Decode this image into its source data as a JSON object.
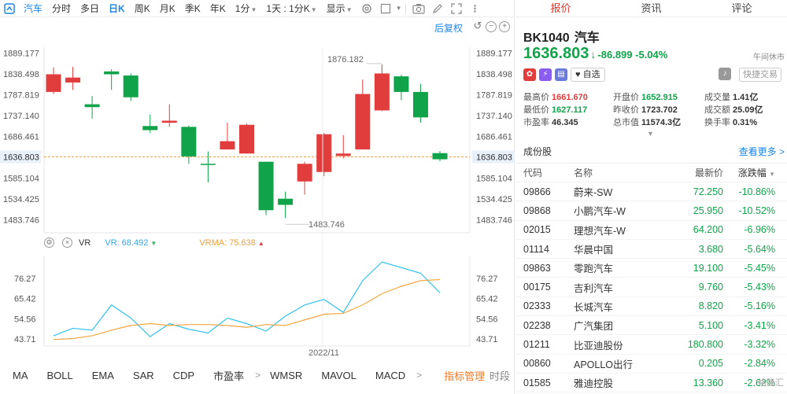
{
  "toolbar": {
    "items": [
      "汽车",
      "分时",
      "多日",
      "日K",
      "周K",
      "月K",
      "季K",
      "年K",
      "1分",
      "1天 : 1分K",
      "显示"
    ],
    "active_index": 3
  },
  "chart": {
    "fuquan_label": "后复权",
    "y_ticks": [
      "1889.177",
      "1838.498",
      "1787.819",
      "1737.140",
      "1686.461",
      "1636.803",
      "1585.104",
      "1534.425",
      "1483.746"
    ],
    "current_price_label": "1636.803",
    "high_label": "1876.182",
    "low_label": "1483.746",
    "x_label": "2022/11",
    "indicator": {
      "name": "VR",
      "vr_label": "VR: 68.492",
      "vrma_label": "VRMA: 75.638",
      "y_ticks": [
        "76.27",
        "65.42",
        "54.56",
        "43.71"
      ]
    }
  },
  "chart_data": [
    {
      "type": "candlestick",
      "ylim": [
        1452,
        1904
      ],
      "candles": [
        {
          "open": 1795,
          "close": 1838,
          "high": 1855,
          "low": 1790
        },
        {
          "open": 1818,
          "close": 1830,
          "high": 1856,
          "low": 1800
        },
        {
          "open": 1765,
          "close": 1758,
          "high": 1785,
          "low": 1730
        },
        {
          "open": 1845,
          "close": 1838,
          "high": 1850,
          "low": 1800
        },
        {
          "open": 1835,
          "close": 1782,
          "high": 1840,
          "low": 1773
        },
        {
          "open": 1712,
          "close": 1702,
          "high": 1740,
          "low": 1695
        },
        {
          "open": 1720,
          "close": 1725,
          "high": 1765,
          "low": 1710
        },
        {
          "open": 1710,
          "close": 1638,
          "high": 1713,
          "low": 1620
        },
        {
          "open": 1620,
          "close": 1618,
          "high": 1650,
          "low": 1575
        },
        {
          "open": 1655,
          "close": 1675,
          "high": 1720,
          "low": 1655
        },
        {
          "open": 1645,
          "close": 1715,
          "high": 1718,
          "low": 1645
        },
        {
          "open": 1625,
          "close": 1507,
          "high": 1625,
          "low": 1495
        },
        {
          "open": 1535,
          "close": 1520,
          "high": 1552,
          "low": 1488
        },
        {
          "open": 1577,
          "close": 1620,
          "high": 1625,
          "low": 1545
        },
        {
          "open": 1600,
          "close": 1692,
          "high": 1695,
          "low": 1590
        },
        {
          "open": 1639,
          "close": 1645,
          "high": 1690,
          "low": 1633
        },
        {
          "open": 1655,
          "close": 1790,
          "high": 1825,
          "low": 1655
        },
        {
          "open": 1750,
          "close": 1840,
          "high": 1862,
          "low": 1748
        },
        {
          "open": 1833,
          "close": 1795,
          "high": 1837,
          "low": 1775
        },
        {
          "open": 1795,
          "close": 1733,
          "high": 1815,
          "low": 1720
        },
        {
          "open": 1646,
          "close": 1631,
          "high": 1651,
          "low": 1626
        }
      ]
    },
    {
      "type": "line",
      "ylim": [
        40,
        88
      ],
      "series": [
        {
          "name": "VR",
          "values": [
            45.5,
            49.5,
            48.5,
            62,
            55,
            45,
            52,
            49,
            47,
            55,
            52,
            48,
            56,
            62,
            65,
            58,
            75,
            85,
            82,
            79,
            68.5
          ]
        },
        {
          "name": "VRMA",
          "values": [
            43.5,
            44,
            45.5,
            48.5,
            51,
            52,
            51,
            51.5,
            51.5,
            51,
            50,
            51.5,
            51,
            54,
            57,
            57.5,
            62,
            68,
            72,
            75,
            75.6
          ]
        }
      ]
    }
  ],
  "bottom_tabs": [
    "MA",
    "BOLL",
    "EMA",
    "SAR",
    "CDP",
    "市盈率",
    "WMSR",
    "MAVOL",
    "MACD"
  ],
  "bottom_active": "指标管理",
  "bottom_time": "时段",
  "right": {
    "tabs": [
      "报价",
      "资讯",
      "评论"
    ],
    "code": "BK1040",
    "name": "汽车",
    "price": "1636.803",
    "arrow": "↓",
    "change": "-86.899",
    "change_pct": "-5.04%",
    "market_status": "午间休市",
    "zixuan_label": "自选",
    "quick_trade_label": "快捷交易",
    "stats": [
      [
        {
          "label": "最高价",
          "value": "1661.670",
          "cls": "up"
        },
        {
          "label": "开盘价",
          "value": "1652.915",
          "cls": "down"
        },
        {
          "label": "成交量",
          "value": "1.41亿",
          "cls": "neutral"
        }
      ],
      [
        {
          "label": "最低价",
          "value": "1627.117",
          "cls": "down"
        },
        {
          "label": "昨收价",
          "value": "1723.702",
          "cls": "neutral"
        },
        {
          "label": "成交额",
          "value": "25.09亿",
          "cls": "neutral"
        }
      ],
      [
        {
          "label": "市盈率",
          "value": "46.345",
          "cls": "neutral"
        },
        {
          "label": "总市值",
          "value": "11574.3亿",
          "cls": "neutral"
        },
        {
          "label": "换手率",
          "value": "0.31%",
          "cls": "neutral"
        }
      ]
    ],
    "constituents_title": "成份股",
    "constituents_more": "查看更多",
    "table_headers": [
      "代码",
      "名称",
      "最新价",
      "涨跌幅"
    ],
    "rows": [
      [
        "09866",
        "蔚来-SW",
        "72.250",
        "-10.86%"
      ],
      [
        "09868",
        "小鹏汽车-W",
        "25.950",
        "-10.52%"
      ],
      [
        "02015",
        "理想汽车-W",
        "64.200",
        "-6.96%"
      ],
      [
        "01114",
        "华晨中国",
        "3.680",
        "-5.64%"
      ],
      [
        "09863",
        "零跑汽车",
        "19.100",
        "-5.45%"
      ],
      [
        "00175",
        "吉利汽车",
        "9.760",
        "-5.43%"
      ],
      [
        "02333",
        "长城汽车",
        "8.820",
        "-5.16%"
      ],
      [
        "02238",
        "广汽集团",
        "5.100",
        "-3.41%"
      ],
      [
        "01211",
        "比亚迪股份",
        "180.800",
        "-3.32%"
      ],
      [
        "00860",
        "APOLLO出行",
        "0.205",
        "-2.84%"
      ],
      [
        "01585",
        "雅迪控股",
        "13.360",
        "-2.62%"
      ]
    ],
    "watermark": "格隆汇"
  },
  "colors": {
    "up": "#e23d3d",
    "down": "#10a34a",
    "accent": "#1f86e6",
    "vr": "#32c0f0",
    "vrma": "#f4a640"
  }
}
